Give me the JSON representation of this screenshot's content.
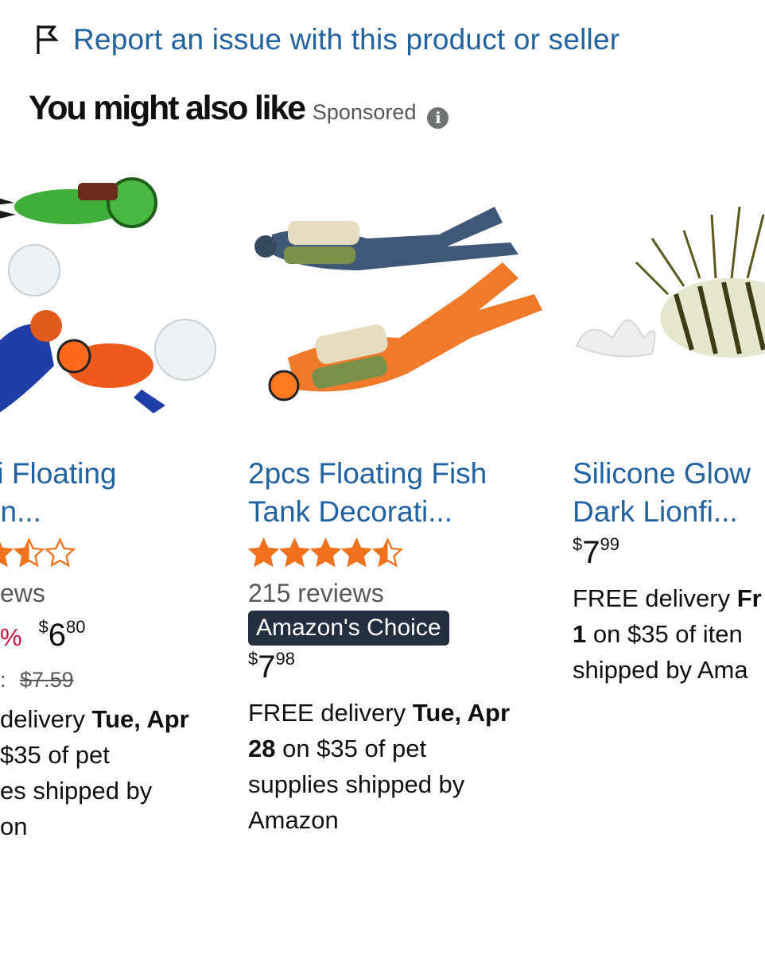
{
  "report_link": {
    "label": "Report an issue with this product or seller"
  },
  "section": {
    "title": "You might also like",
    "sponsored": "Sponsored"
  },
  "colors": {
    "link": "#2162a1",
    "star": "#f2711c",
    "badge_bg": "#232f3e",
    "discount": "#cc0c39"
  },
  "products": [
    {
      "title_lines": [
        "yyami Floating",
        " Figurin..."
      ],
      "rating": 3.5,
      "reviews": "ews",
      "discount": "%",
      "price": {
        "symbol": "$",
        "whole": "6",
        "fraction": "80"
      },
      "list_price": {
        "label": ":",
        "value": "$7.59"
      },
      "delivery_lines": [
        {
          "normal": "delivery ",
          "bold": "Tue, Apr"
        },
        {
          "normal": " $35 of pet",
          "bold": ""
        },
        {
          "normal": "es shipped by",
          "bold": ""
        },
        {
          "normal": "on",
          "bold": ""
        }
      ]
    },
    {
      "title_lines": [
        "2pcs Floating Fish",
        "Tank Decorati..."
      ],
      "rating": 4.5,
      "reviews": "215 reviews",
      "badge": "Amazon's Choice",
      "price": {
        "symbol": "$",
        "whole": "7",
        "fraction": "98"
      },
      "delivery_lines": [
        {
          "normal": "FREE delivery ",
          "bold": "Tue, Apr"
        },
        {
          "normal": " on $35 of pet",
          "bold": "28"
        },
        {
          "normal": "supplies shipped by",
          "bold": ""
        },
        {
          "normal": "Amazon",
          "bold": ""
        }
      ]
    },
    {
      "title_lines": [
        "Silicone Glow",
        "Dark Lionfi..."
      ],
      "price": {
        "symbol": "$",
        "whole": "7",
        "fraction": "99"
      },
      "delivery_lines": [
        {
          "normal": "FREE delivery ",
          "bold": "Fr"
        },
        {
          "normal": " on $35 of iten",
          "bold": "1"
        },
        {
          "normal": "shipped by Ama",
          "bold": ""
        }
      ]
    }
  ]
}
